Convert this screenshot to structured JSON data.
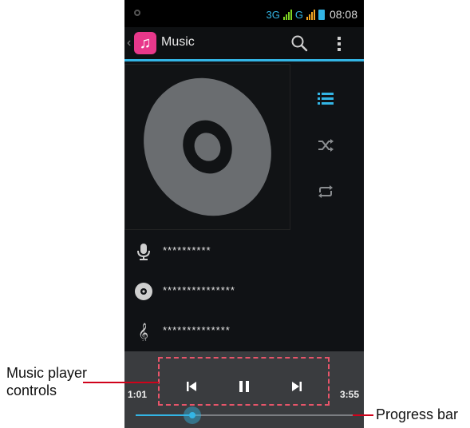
{
  "status_bar": {
    "network_left": "3G",
    "network_right": "G",
    "time": "08:08"
  },
  "action_bar": {
    "title": "Music",
    "back_glyph": "‹"
  },
  "side_actions": [
    {
      "name": "playlist-icon"
    },
    {
      "name": "shuffle-icon"
    },
    {
      "name": "repeat-icon"
    }
  ],
  "track_info": {
    "artist": "**********",
    "album": "***************",
    "title": "**************"
  },
  "player": {
    "elapsed": "1:01",
    "duration": "3:55",
    "progress_fraction": 0.26
  },
  "annotations": {
    "controls_label_line1": "Music player",
    "controls_label_line2": "controls",
    "progress_label": "Progress bar"
  },
  "colors": {
    "accent": "#33b5e5",
    "app_icon": "#e8388b",
    "annotation": "#d0021b"
  }
}
